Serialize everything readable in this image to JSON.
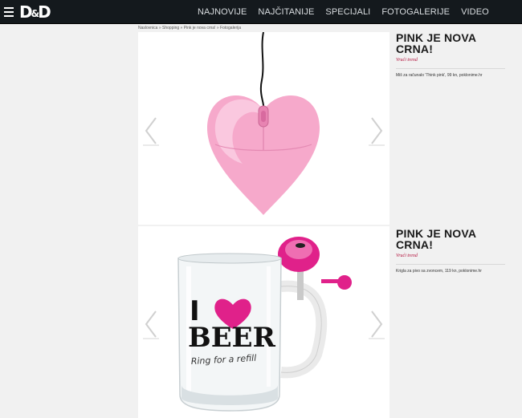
{
  "header": {
    "logo_text": "D&D",
    "nav": [
      "NAJNOVIJE",
      "NAJČITANIJE",
      "SPECIJALI",
      "FOTOGALERIJE",
      "VIDEO"
    ]
  },
  "breadcrumb": "Naslovnica » Shopping » Pink je nova crna! » Fotogalerija",
  "gallery": [
    {
      "title": "PINK JE NOVA CRNA!",
      "category": "Vrući trend",
      "description": "Miš za računalo 'Think pink', 99 kn, poklonime.hr",
      "icon": "heart-mouse-image"
    },
    {
      "title": "PINK JE NOVA CRNA!",
      "category": "Vrući trend",
      "description": "Krigla za pivo sa zvoncem, 119 kn, poklonime.hr",
      "icon": "beer-mug-image",
      "mug_text": {
        "line1": "I",
        "line2": "BEER",
        "line3": "Ring for a refill"
      }
    }
  ],
  "colors": {
    "topbar": "#14191d",
    "accent": "#b20f3a",
    "pink": "#f5a3c8",
    "magenta": "#e0218a"
  }
}
